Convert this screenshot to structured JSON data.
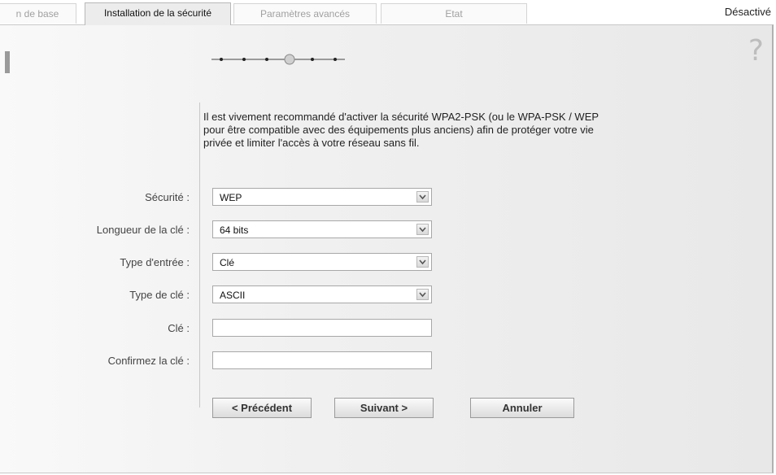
{
  "tabs": [
    {
      "label": "n de base"
    },
    {
      "label": "Installation de la sécurité"
    },
    {
      "label": "Paramètres avancés"
    },
    {
      "label": "Etat"
    }
  ],
  "status_text": "Désactivé",
  "wizard": {
    "total_steps": 6,
    "current_step": 4
  },
  "intro_text": "Il est vivement recommandé d'activer la sécurité WPA2-PSK (ou le WPA-PSK / WEP pour être compatible avec des équipements plus anciens) afin de protéger votre vie privée et limiter l'accès à votre réseau sans fil.",
  "form": {
    "security": {
      "label": "Sécurité :",
      "value": "WEP"
    },
    "key_length": {
      "label": "Longueur de la clé :",
      "value": "64 bits"
    },
    "entry_type": {
      "label": "Type d'entrée :",
      "value": "Clé"
    },
    "key_type": {
      "label": "Type de clé :",
      "value": "ASCII"
    },
    "key": {
      "label": "Clé :",
      "value": ""
    },
    "confirm_key": {
      "label": "Confirmez la clé :",
      "value": ""
    }
  },
  "buttons": {
    "previous": "< Précédent",
    "next": "Suivant >",
    "cancel": "Annuler"
  },
  "help_glyph": "?"
}
